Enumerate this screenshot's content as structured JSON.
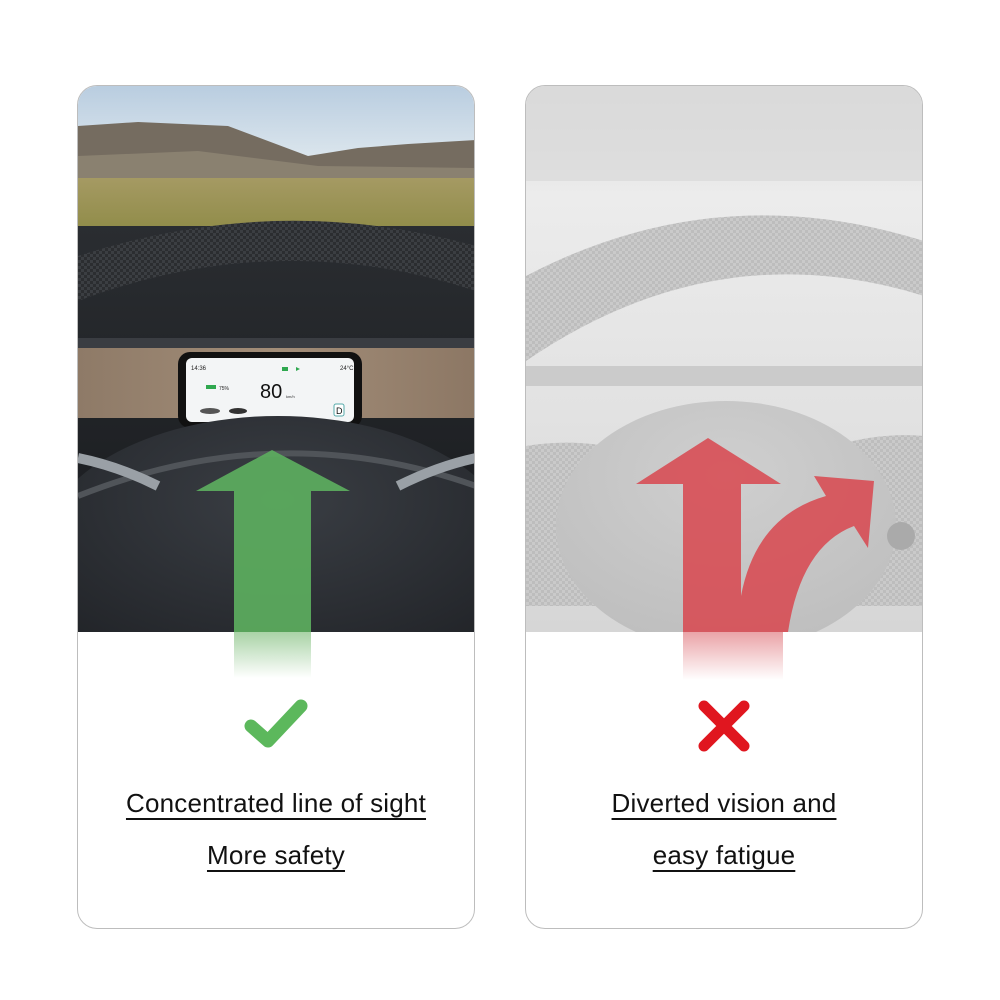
{
  "cards": [
    {
      "id": "good",
      "scene": "landscape-with-dashboard-display",
      "arrow_color": "#5cae5e",
      "mark_icon": "check-icon",
      "mark_color": "#5cb85c",
      "caption_line1": "Concentrated line of sight",
      "caption_line2": "More safety",
      "display": {
        "time": "14:36",
        "temperature": "24°C",
        "battery": "75%",
        "speed": "80",
        "speed_unit": "km/h",
        "gear": "D"
      }
    },
    {
      "id": "bad",
      "scene": "faded-steering-wheel",
      "arrow_color": "#d9474f",
      "mark_icon": "cross-icon",
      "mark_color": "#e0161f",
      "caption_line1": "Diverted vision and",
      "caption_line2": "easy fatigue"
    }
  ]
}
